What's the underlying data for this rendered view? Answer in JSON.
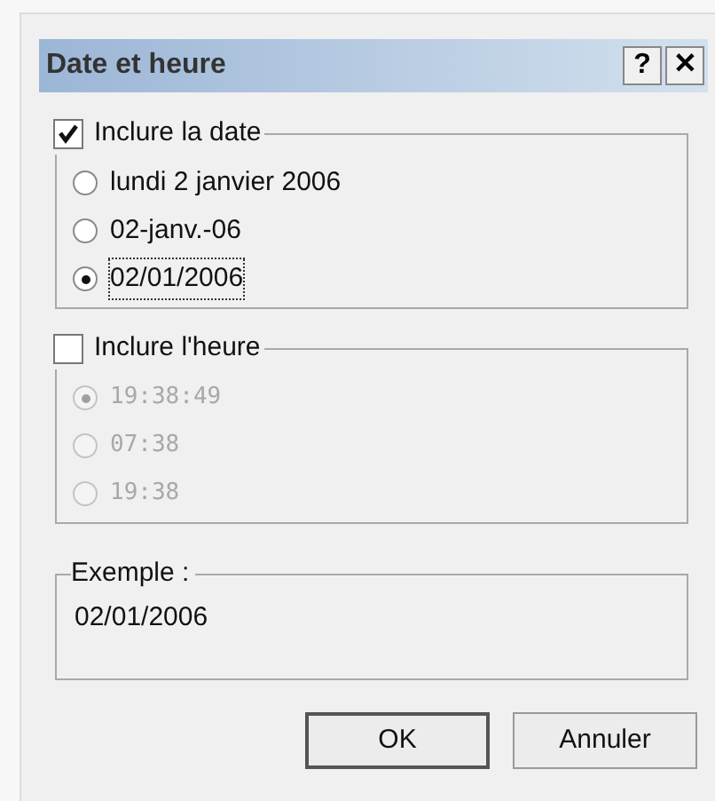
{
  "window": {
    "title": "Date et heure",
    "help_button": "?",
    "close_button": "✕"
  },
  "date_group": {
    "label": "Inclure la date",
    "checked": true,
    "disabled": false,
    "options": [
      {
        "label": "lundi 2 janvier 2006",
        "selected": false,
        "focused": false
      },
      {
        "label": "02-janv.-06",
        "selected": false,
        "focused": false
      },
      {
        "label": "02/01/2006",
        "selected": true,
        "focused": true
      }
    ]
  },
  "time_group": {
    "label": "Inclure l'heure",
    "checked": false,
    "disabled": true,
    "options": [
      {
        "label": "19:38:49",
        "selected": true,
        "focused": false
      },
      {
        "label": "07:38",
        "selected": false,
        "focused": false
      },
      {
        "label": "19:38",
        "selected": false,
        "focused": false
      }
    ]
  },
  "example": {
    "label": "Exemple :",
    "value": "02/01/2006"
  },
  "buttons": [
    {
      "label": "OK",
      "default": true
    },
    {
      "label": "Annuler",
      "default": false
    }
  ]
}
